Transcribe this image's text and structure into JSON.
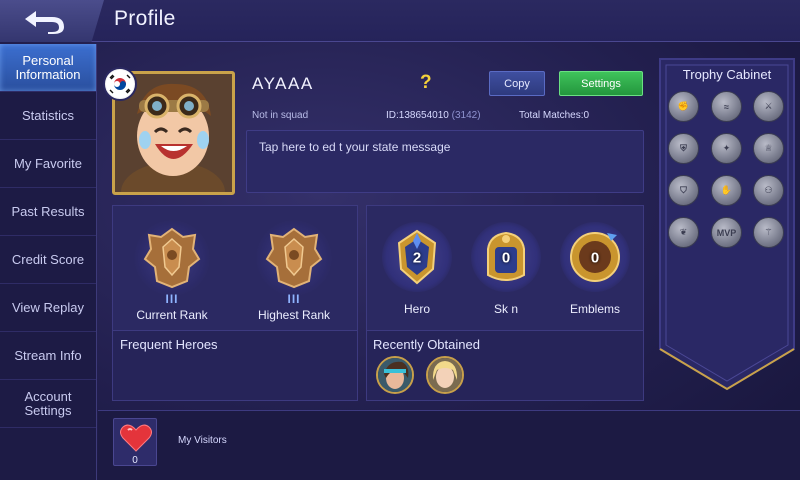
{
  "header": {
    "title": "Profile",
    "back_icon": "back-arrow-icon"
  },
  "sidebar": {
    "items": [
      {
        "label": "Personal Information",
        "active": true
      },
      {
        "label": "Statistics",
        "active": false
      },
      {
        "label": "My Favorite",
        "active": false
      },
      {
        "label": "Past Results",
        "active": false
      },
      {
        "label": "Credit Score",
        "active": false
      },
      {
        "label": "View Replay",
        "active": false
      },
      {
        "label": "Stream Info",
        "active": false
      },
      {
        "label": "Account Settings",
        "active": false
      }
    ]
  },
  "profile": {
    "name": "AYAAA",
    "question_mark": "?",
    "copy_label": "Copy",
    "settings_label": "Settings",
    "squad_status": "Not in squad",
    "id_label": "ID:138654010",
    "id_server": "(3142)",
    "total_matches": "Total Matches:0",
    "state_message_placeholder": "Tap here to ed t your state message",
    "flag_icon": "south-korea-flag-icon"
  },
  "ranks": {
    "current": {
      "tier": "III",
      "label": "Current Rank"
    },
    "highest": {
      "tier": "III",
      "label": "Highest Rank"
    }
  },
  "frequent_heroes": {
    "title": "Frequent Heroes"
  },
  "collection": {
    "hero": {
      "count": "2",
      "label": "Hero"
    },
    "skin": {
      "count": "0",
      "label": "Sk n"
    },
    "emblems": {
      "count": "0",
      "label": "Emblems"
    }
  },
  "recently_obtained": {
    "title": "Recently Obtained"
  },
  "trophy_cabinet": {
    "title": "Trophy Cabinet",
    "icons": [
      "trophy-fist-icon",
      "trophy-wing-icon",
      "trophy-blade-icon",
      "trophy-shield-icon",
      "trophy-star-icon",
      "trophy-cup-icon",
      "trophy-helm-icon",
      "trophy-hand-icon",
      "trophy-people-icon",
      "trophy-laurel-icon",
      "trophy-mvp-icon",
      "trophy-claw-icon"
    ],
    "mvp_text": "MVP"
  },
  "visitors": {
    "count": "0",
    "label": "My Visitors"
  },
  "colors": {
    "accent_blue": "#3c6fd0",
    "settings_green": "#3fc35b",
    "gold": "#c9a24a",
    "background": "#221f4e"
  }
}
